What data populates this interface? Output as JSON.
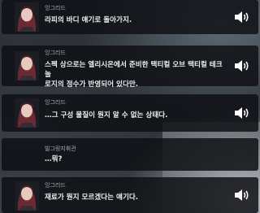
{
  "dialogue": [
    {
      "speaker": "잉그리드",
      "text": "라피의 바디 얘기로 돌아가지."
    },
    {
      "speaker": "잉그리드",
      "text": "스펙 상으로는 엘리시온에서 준비한 택티컬 오브 택티컬 테크놀\n로지의 정수가 반영되어 있다만."
    },
    {
      "speaker": "잉그리드",
      "text": "…그 구성 물질이 뭔지 알 수 없는 상태다."
    },
    {
      "speaker": "빌그링지휘관",
      "text": "…뭐?"
    },
    {
      "speaker": "잉그리드",
      "text": "재료가 뭔지 모르겠다는 얘기다."
    }
  ],
  "icons": {
    "audio": "speaker-volume-icon",
    "avatar": "ingrid-portrait"
  }
}
